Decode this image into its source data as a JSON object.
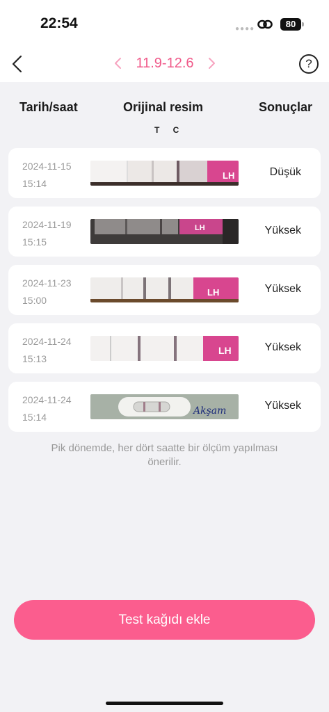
{
  "status_bar": {
    "time": "22:54",
    "battery": "80"
  },
  "nav": {
    "range": "11.9-12.6"
  },
  "columns": {
    "date": "Tarih/saat",
    "image": "Orijinal resim",
    "result": "Sonuçlar",
    "tc": "T C"
  },
  "records": [
    {
      "date": "2024-11-15",
      "time": "15:14",
      "result": "Düşük",
      "strip_label": "LH"
    },
    {
      "date": "2024-11-19",
      "time": "15:15",
      "result": "Yüksek",
      "strip_label": "LH"
    },
    {
      "date": "2024-11-23",
      "time": "15:00",
      "result": "Yüksek",
      "strip_label": "LH"
    },
    {
      "date": "2024-11-24",
      "time": "15:13",
      "result": "Yüksek",
      "strip_label": "LH"
    },
    {
      "date": "2024-11-24",
      "time": "15:14",
      "result": "Yüksek",
      "strip_label": "Akşam"
    }
  ],
  "hint": "Pik dönemde, her dört saatte bir ölçüm yapılması önerilir.",
  "add_button": "Test kağıdı ekle",
  "colors": {
    "accent": "#fb5d8e",
    "range_text": "#f05a8a",
    "strip_pink": "#d8468f"
  }
}
